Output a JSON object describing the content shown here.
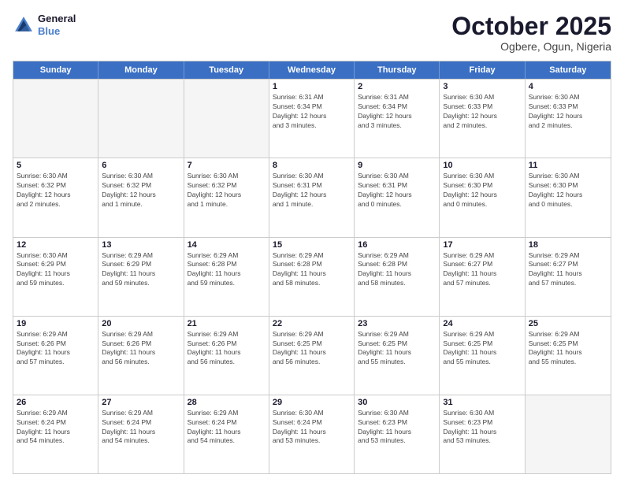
{
  "logo": {
    "line1": "General",
    "line2": "Blue"
  },
  "title": "October 2025",
  "subtitle": "Ogbere, Ogun, Nigeria",
  "days_of_week": [
    "Sunday",
    "Monday",
    "Tuesday",
    "Wednesday",
    "Thursday",
    "Friday",
    "Saturday"
  ],
  "weeks": [
    [
      {
        "day": "",
        "info": ""
      },
      {
        "day": "",
        "info": ""
      },
      {
        "day": "",
        "info": ""
      },
      {
        "day": "1",
        "info": "Sunrise: 6:31 AM\nSunset: 6:34 PM\nDaylight: 12 hours\nand 3 minutes."
      },
      {
        "day": "2",
        "info": "Sunrise: 6:31 AM\nSunset: 6:34 PM\nDaylight: 12 hours\nand 3 minutes."
      },
      {
        "day": "3",
        "info": "Sunrise: 6:30 AM\nSunset: 6:33 PM\nDaylight: 12 hours\nand 2 minutes."
      },
      {
        "day": "4",
        "info": "Sunrise: 6:30 AM\nSunset: 6:33 PM\nDaylight: 12 hours\nand 2 minutes."
      }
    ],
    [
      {
        "day": "5",
        "info": "Sunrise: 6:30 AM\nSunset: 6:32 PM\nDaylight: 12 hours\nand 2 minutes."
      },
      {
        "day": "6",
        "info": "Sunrise: 6:30 AM\nSunset: 6:32 PM\nDaylight: 12 hours\nand 1 minute."
      },
      {
        "day": "7",
        "info": "Sunrise: 6:30 AM\nSunset: 6:32 PM\nDaylight: 12 hours\nand 1 minute."
      },
      {
        "day": "8",
        "info": "Sunrise: 6:30 AM\nSunset: 6:31 PM\nDaylight: 12 hours\nand 1 minute."
      },
      {
        "day": "9",
        "info": "Sunrise: 6:30 AM\nSunset: 6:31 PM\nDaylight: 12 hours\nand 0 minutes."
      },
      {
        "day": "10",
        "info": "Sunrise: 6:30 AM\nSunset: 6:30 PM\nDaylight: 12 hours\nand 0 minutes."
      },
      {
        "day": "11",
        "info": "Sunrise: 6:30 AM\nSunset: 6:30 PM\nDaylight: 12 hours\nand 0 minutes."
      }
    ],
    [
      {
        "day": "12",
        "info": "Sunrise: 6:30 AM\nSunset: 6:29 PM\nDaylight: 11 hours\nand 59 minutes."
      },
      {
        "day": "13",
        "info": "Sunrise: 6:29 AM\nSunset: 6:29 PM\nDaylight: 11 hours\nand 59 minutes."
      },
      {
        "day": "14",
        "info": "Sunrise: 6:29 AM\nSunset: 6:28 PM\nDaylight: 11 hours\nand 59 minutes."
      },
      {
        "day": "15",
        "info": "Sunrise: 6:29 AM\nSunset: 6:28 PM\nDaylight: 11 hours\nand 58 minutes."
      },
      {
        "day": "16",
        "info": "Sunrise: 6:29 AM\nSunset: 6:28 PM\nDaylight: 11 hours\nand 58 minutes."
      },
      {
        "day": "17",
        "info": "Sunrise: 6:29 AM\nSunset: 6:27 PM\nDaylight: 11 hours\nand 57 minutes."
      },
      {
        "day": "18",
        "info": "Sunrise: 6:29 AM\nSunset: 6:27 PM\nDaylight: 11 hours\nand 57 minutes."
      }
    ],
    [
      {
        "day": "19",
        "info": "Sunrise: 6:29 AM\nSunset: 6:26 PM\nDaylight: 11 hours\nand 57 minutes."
      },
      {
        "day": "20",
        "info": "Sunrise: 6:29 AM\nSunset: 6:26 PM\nDaylight: 11 hours\nand 56 minutes."
      },
      {
        "day": "21",
        "info": "Sunrise: 6:29 AM\nSunset: 6:26 PM\nDaylight: 11 hours\nand 56 minutes."
      },
      {
        "day": "22",
        "info": "Sunrise: 6:29 AM\nSunset: 6:25 PM\nDaylight: 11 hours\nand 56 minutes."
      },
      {
        "day": "23",
        "info": "Sunrise: 6:29 AM\nSunset: 6:25 PM\nDaylight: 11 hours\nand 55 minutes."
      },
      {
        "day": "24",
        "info": "Sunrise: 6:29 AM\nSunset: 6:25 PM\nDaylight: 11 hours\nand 55 minutes."
      },
      {
        "day": "25",
        "info": "Sunrise: 6:29 AM\nSunset: 6:25 PM\nDaylight: 11 hours\nand 55 minutes."
      }
    ],
    [
      {
        "day": "26",
        "info": "Sunrise: 6:29 AM\nSunset: 6:24 PM\nDaylight: 11 hours\nand 54 minutes."
      },
      {
        "day": "27",
        "info": "Sunrise: 6:29 AM\nSunset: 6:24 PM\nDaylight: 11 hours\nand 54 minutes."
      },
      {
        "day": "28",
        "info": "Sunrise: 6:29 AM\nSunset: 6:24 PM\nDaylight: 11 hours\nand 54 minutes."
      },
      {
        "day": "29",
        "info": "Sunrise: 6:30 AM\nSunset: 6:24 PM\nDaylight: 11 hours\nand 53 minutes."
      },
      {
        "day": "30",
        "info": "Sunrise: 6:30 AM\nSunset: 6:23 PM\nDaylight: 11 hours\nand 53 minutes."
      },
      {
        "day": "31",
        "info": "Sunrise: 6:30 AM\nSunset: 6:23 PM\nDaylight: 11 hours\nand 53 minutes."
      },
      {
        "day": "",
        "info": ""
      }
    ]
  ]
}
